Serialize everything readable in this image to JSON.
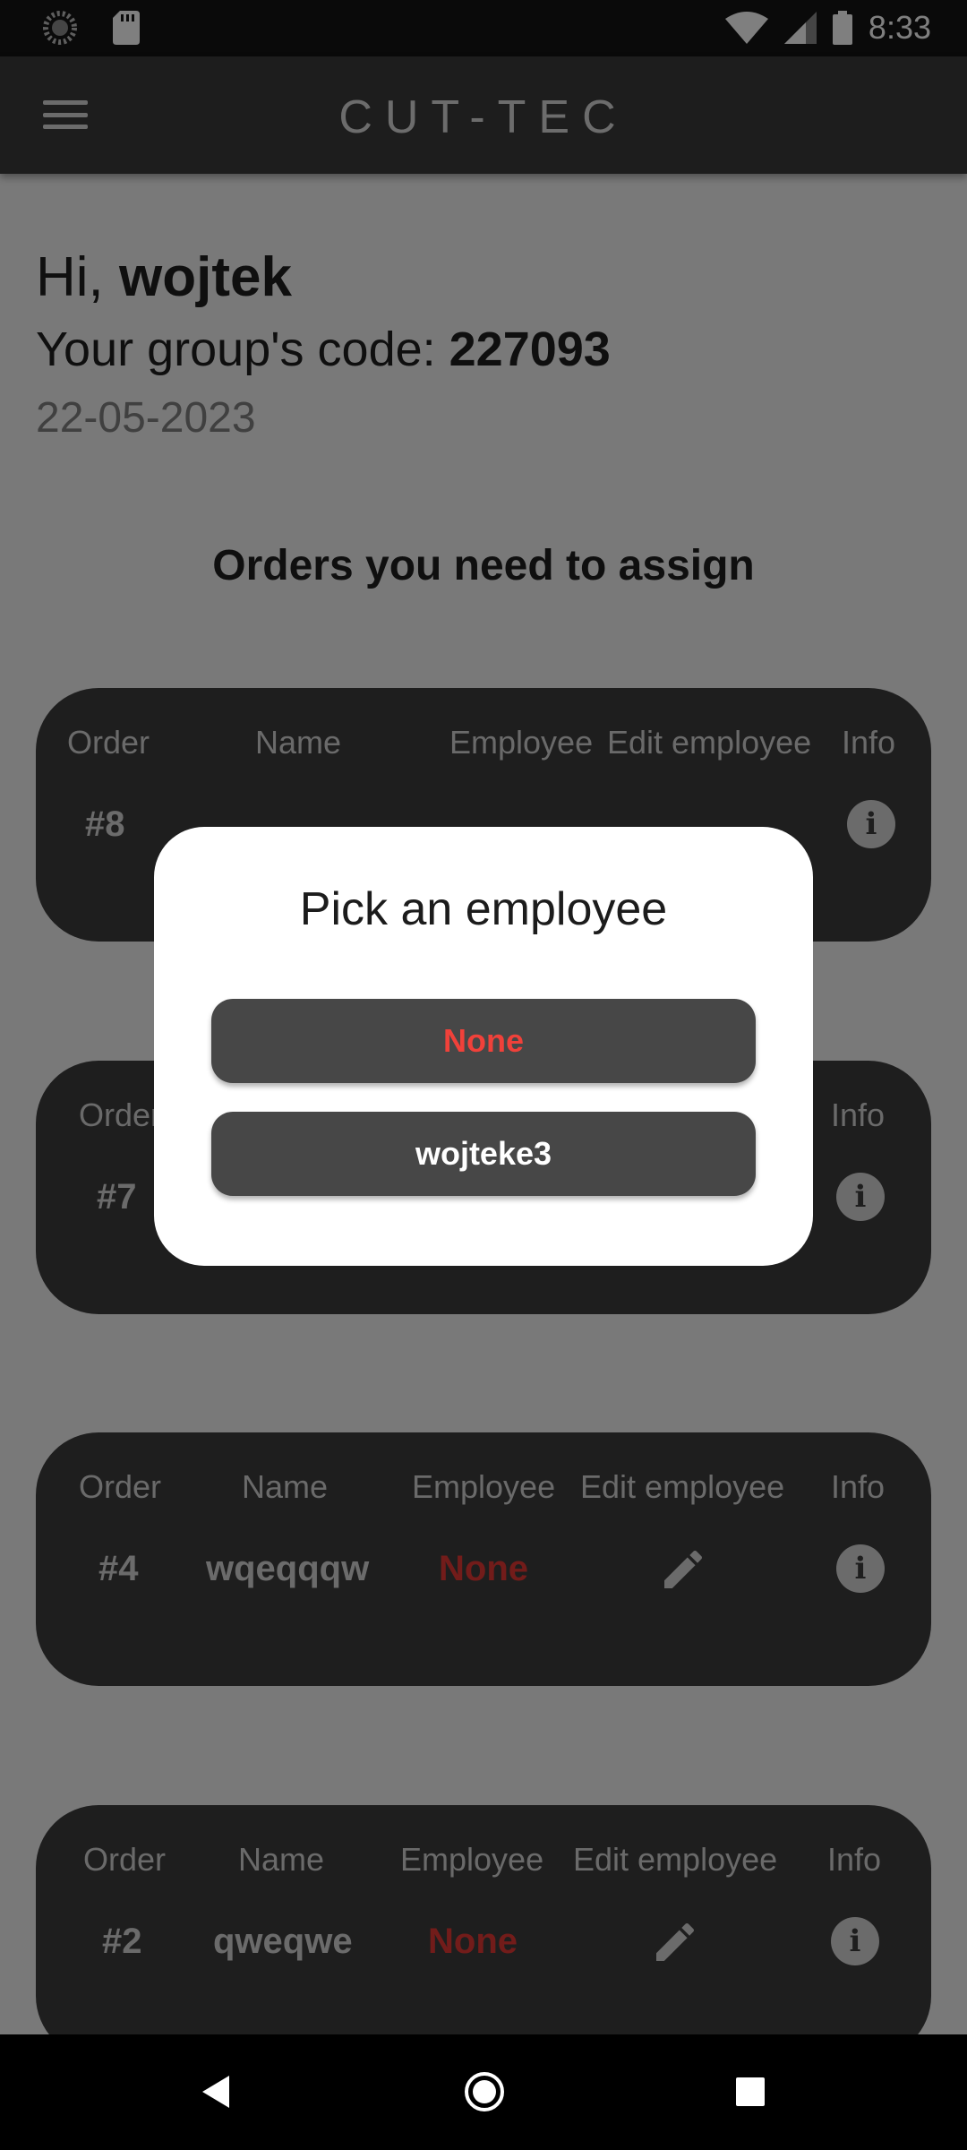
{
  "status_bar": {
    "time": "8:33",
    "icons": [
      "loading-icon",
      "sd-card-icon",
      "wifi-icon",
      "signal-icon",
      "battery-icon"
    ]
  },
  "app_bar": {
    "title": "CUT-TEC",
    "menu_icon": "menu-icon"
  },
  "header": {
    "greeting_prefix": "Hi, ",
    "user_name": "wojtek",
    "group_code_prefix": "Your group's code: ",
    "group_code": "227093",
    "date": "22-05-2023"
  },
  "section_title": "Orders you need to assign",
  "columns": {
    "order": "Order",
    "name": "Name",
    "employee": "Employee",
    "edit_employee": "Edit employee",
    "info": "Info"
  },
  "orders": [
    {
      "order": "#8",
      "name": "",
      "employee": ""
    },
    {
      "order": "#7",
      "name": "",
      "employee": ""
    },
    {
      "order": "#4",
      "name": "wqeqqqw",
      "employee": "None"
    },
    {
      "order": "#2",
      "name": "qweqwe",
      "employee": "None"
    }
  ],
  "dialog": {
    "title": "Pick an employee",
    "options": [
      "None",
      "wojteke3"
    ]
  },
  "colors": {
    "accent_red": "#e53935",
    "card_bg": "#3d3d3d",
    "app_bar_bg": "#3a3a3a"
  }
}
